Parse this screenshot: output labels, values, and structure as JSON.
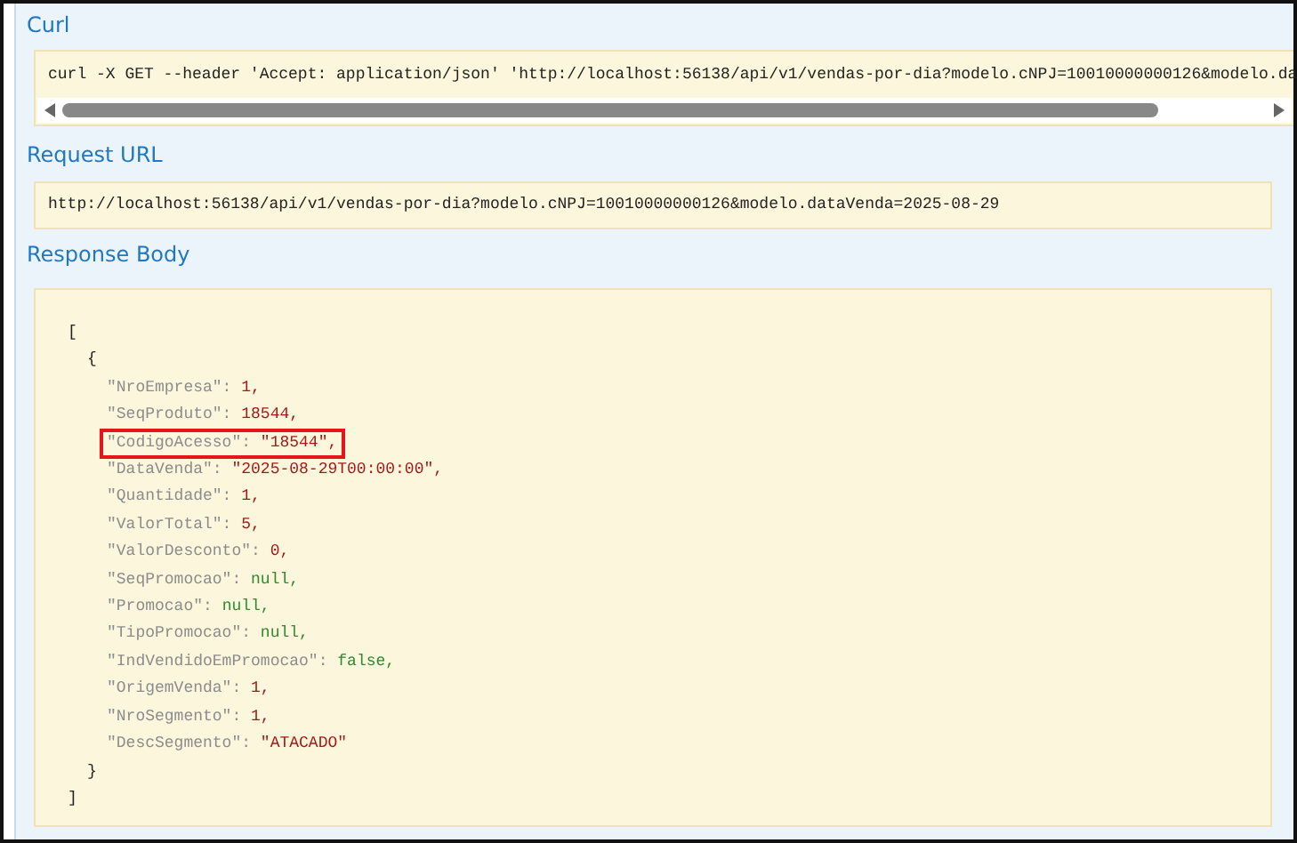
{
  "curl": {
    "heading": "Curl",
    "command": "curl -X GET --header 'Accept: application/json' 'http://localhost:56138/api/v1/vendas-por-dia?modelo.cNPJ=10010000000126&modelo.da"
  },
  "request_url": {
    "heading": "Request URL",
    "url": "http://localhost:56138/api/v1/vendas-por-dia?modelo.cNPJ=10010000000126&modelo.dataVenda=2025-08-29"
  },
  "response_body": {
    "heading": "Response Body",
    "open": "[",
    "close": "]",
    "objects": [
      {
        "open": "{",
        "close": "}",
        "fields": [
          {
            "key": "\"NroEmpresa\":",
            "value": "1,",
            "kind": "number",
            "highlighted": false
          },
          {
            "key": "\"SeqProduto\":",
            "value": "18544,",
            "kind": "number",
            "highlighted": false
          },
          {
            "key": "\"CodigoAcesso\":",
            "value": "\"18544\",",
            "kind": "string",
            "highlighted": true
          },
          {
            "key": "\"DataVenda\":",
            "value": "\"2025-08-29T00:00:00\",",
            "kind": "string",
            "highlighted": false
          },
          {
            "key": "\"Quantidade\":",
            "value": "1,",
            "kind": "number",
            "highlighted": false
          },
          {
            "key": "\"ValorTotal\":",
            "value": "5,",
            "kind": "number",
            "highlighted": false
          },
          {
            "key": "\"ValorDesconto\":",
            "value": "0,",
            "kind": "number",
            "highlighted": false
          },
          {
            "key": "\"SeqPromocao\":",
            "value": "null,",
            "kind": "null",
            "highlighted": false
          },
          {
            "key": "\"Promocao\":",
            "value": "null,",
            "kind": "null",
            "highlighted": false
          },
          {
            "key": "\"TipoPromocao\":",
            "value": "null,",
            "kind": "null",
            "highlighted": false
          },
          {
            "key": "\"IndVendidoEmPromocao\":",
            "value": "false,",
            "kind": "boolean",
            "highlighted": false
          },
          {
            "key": "\"OrigemVenda\":",
            "value": "1,",
            "kind": "number",
            "highlighted": false
          },
          {
            "key": "\"NroSegmento\":",
            "value": "1,",
            "kind": "number",
            "highlighted": false
          },
          {
            "key": "\"DescSegmento\":",
            "value": "\"ATACADO\"",
            "kind": "string",
            "highlighted": false
          }
        ]
      }
    ]
  }
}
